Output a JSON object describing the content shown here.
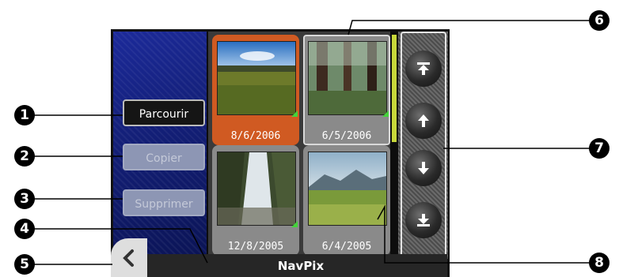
{
  "app": {
    "title": "NavPix"
  },
  "buttons": {
    "browse": "Parcourir",
    "copy": "Copier",
    "delete": "Supprimer"
  },
  "thumbnails": [
    {
      "date": "8/6/2006",
      "selected": true
    },
    {
      "date": "6/5/2006",
      "selected": false
    },
    {
      "date": "12/8/2005",
      "selected": false
    },
    {
      "date": "6/4/2005",
      "selected": false
    }
  ],
  "nav": {
    "top": "⤒",
    "up": "↑",
    "down": "↓",
    "bottom": "⤓",
    "back": "‹"
  },
  "callouts": [
    "1",
    "2",
    "3",
    "4",
    "5",
    "6",
    "7",
    "8"
  ],
  "colors": {
    "selected": "#d05a22",
    "panel_blue": "#14207a",
    "scroll_indicator": "#c8d83a"
  }
}
